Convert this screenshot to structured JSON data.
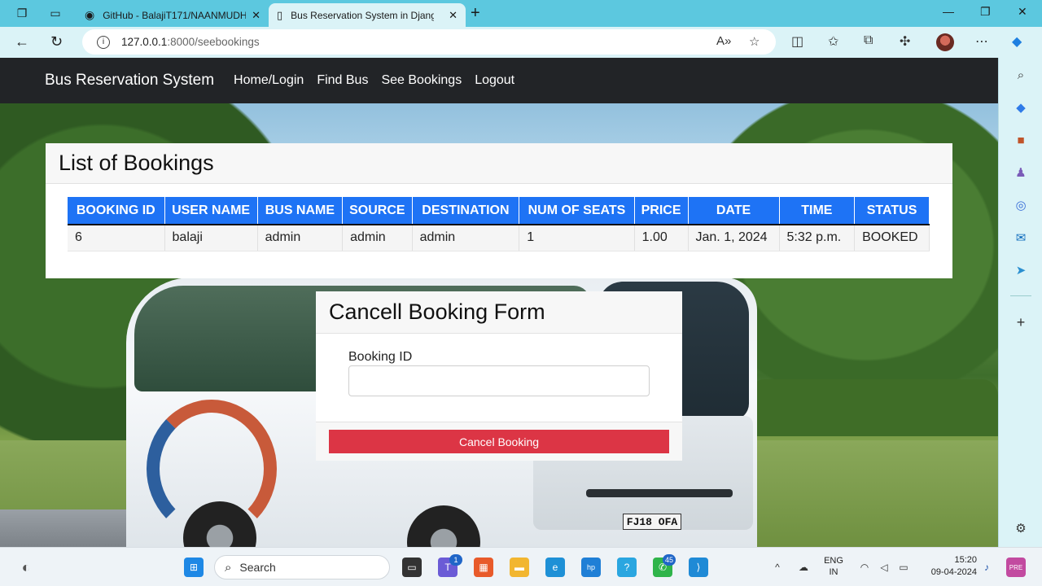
{
  "browser": {
    "tabs": [
      {
        "title": "GitHub - BalajiT171/NAANMUDH",
        "active": false,
        "icon": "github-icon"
      },
      {
        "title": "Bus Reservation System in Djang",
        "active": true,
        "icon": "page-icon"
      }
    ],
    "url_host": "127.0.0.1",
    "url_path": ":8000/seebookings"
  },
  "navbar": {
    "brand": "Bus Reservation System",
    "links": [
      "Home/Login",
      "Find Bus",
      "See Bookings",
      "Logout"
    ]
  },
  "bookings": {
    "title": "List of Bookings",
    "columns": [
      "BOOKING ID",
      "USER NAME",
      "BUS NAME",
      "SOURCE",
      "DESTINATION",
      "NUM OF SEATS",
      "PRICE",
      "DATE",
      "TIME",
      "STATUS"
    ],
    "rows": [
      [
        "6",
        "balaji",
        "admin",
        "admin",
        "admin",
        "1",
        "1.00",
        "Jan. 1, 2024",
        "5:32 p.m.",
        "BOOKED"
      ]
    ]
  },
  "cancel_form": {
    "title": "Cancell Booking Form",
    "label": "Booking ID",
    "input_value": "",
    "button": "Cancel Booking"
  },
  "background": {
    "plate": "FJ18 OFA"
  },
  "taskbar": {
    "search_placeholder": "Search",
    "teams_badge": "1",
    "whatsapp_badge": "45",
    "lang": "ENG",
    "region": "IN",
    "time": "15:20",
    "date": "09-04-2024"
  },
  "colors": {
    "accent": "#1e73f5",
    "danger": "#dc3545",
    "navbar": "#222427",
    "chrome": "#5cc8df"
  }
}
